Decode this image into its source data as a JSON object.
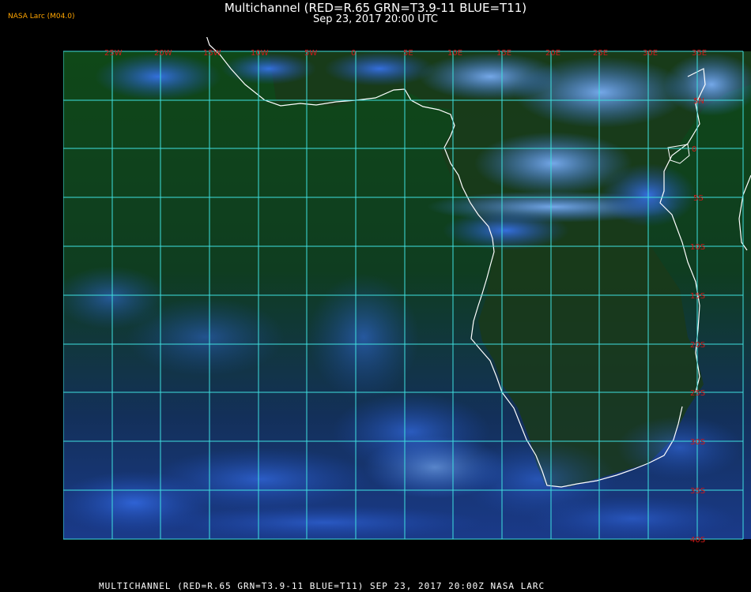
{
  "header": {
    "brand": "NASA Larc (M04.0)",
    "title": "Multichannel (RED=R.65 GRN=T3.9-11 BLUE=T11)",
    "subtitle": "Sep 23, 2017 20:00 UTC"
  },
  "footer": {
    "text": "MULTICHANNEL (RED=R.65 GRN=T3.9-11 BLUE=T11) SEP 23, 2017 20:00Z   NASA LARC"
  },
  "map": {
    "longitude_labels": [
      "25W",
      "20W",
      "15W",
      "10W",
      "5W",
      "0",
      "5E",
      "10E",
      "15E",
      "20E",
      "25E",
      "30E",
      "35E"
    ],
    "latitude_labels": [
      "5N",
      "0",
      "5S",
      "10S",
      "15S",
      "20S",
      "25S",
      "30S",
      "35S",
      "40S"
    ],
    "colors": {
      "grid": "#3fe0e0",
      "coast": "#ffffff",
      "label": "#d01818",
      "land": "#1a3a1a",
      "ocean": "#0f3d14",
      "cloud": "#3a78ff",
      "high_cloud": "#7fb4ff"
    }
  }
}
